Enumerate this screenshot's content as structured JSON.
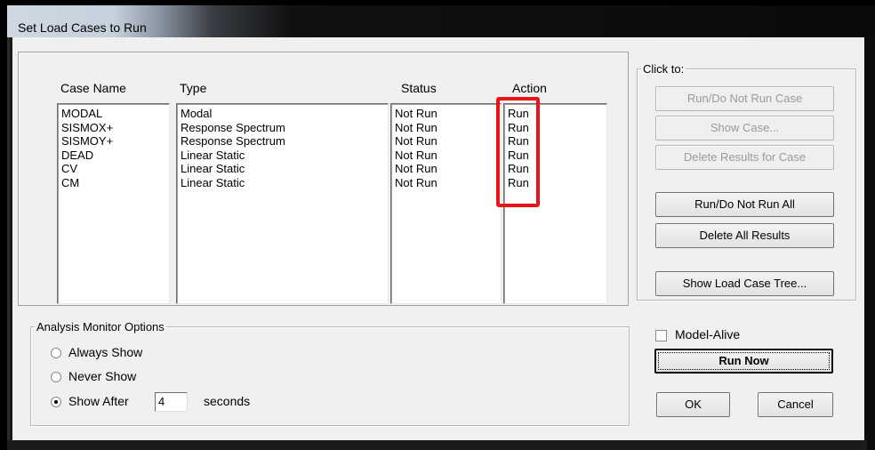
{
  "window": {
    "title": "Set Load Cases to Run"
  },
  "columns": {
    "case_name": "Case Name",
    "type": "Type",
    "status": "Status",
    "action": "Action"
  },
  "cases": [
    {
      "name": "MODAL",
      "type": "Modal",
      "status": "Not Run",
      "action": "Run"
    },
    {
      "name": "SISMOX+",
      "type": "Response Spectrum",
      "status": "Not Run",
      "action": "Run"
    },
    {
      "name": "SISMOY+",
      "type": "Response Spectrum",
      "status": "Not Run",
      "action": "Run"
    },
    {
      "name": "DEAD",
      "type": "Linear Static",
      "status": "Not Run",
      "action": "Run"
    },
    {
      "name": "CV",
      "type": "Linear Static",
      "status": "Not Run",
      "action": "Run"
    },
    {
      "name": "CM",
      "type": "Linear Static",
      "status": "Not Run",
      "action": "Run"
    }
  ],
  "click_to": {
    "legend": "Click to:",
    "run_do_not_run_case": "Run/Do Not Run Case",
    "show_case": "Show Case...",
    "delete_results_for_case": "Delete Results for Case",
    "run_do_not_run_all": "Run/Do Not Run All",
    "delete_all_results": "Delete All Results",
    "show_load_case_tree": "Show Load Case Tree..."
  },
  "monitor": {
    "legend": "Analysis Monitor Options",
    "always_show": "Always Show",
    "never_show": "Never Show",
    "show_after": "Show After",
    "seconds_value": "4",
    "seconds_label": "seconds",
    "selected": "show_after"
  },
  "model_alive": {
    "label": "Model-Alive",
    "checked": false
  },
  "buttons": {
    "run_now": "Run Now",
    "ok": "OK",
    "cancel": "Cancel"
  },
  "colors": {
    "highlight_box": "#e8141a",
    "client_bg": "#f0f0f0"
  }
}
